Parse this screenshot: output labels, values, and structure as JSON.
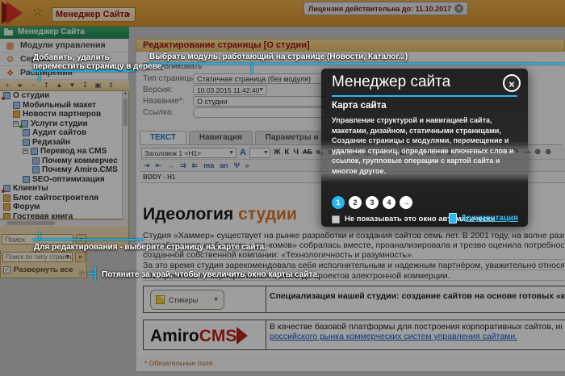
{
  "top_bar": {
    "app_menu_label": "Менеджер Сайта",
    "license_text": "Лицензия действительна до: 11.10.2017",
    "license_close": "×"
  },
  "sidebar": {
    "header": "Менеджер Сайта",
    "menu": [
      {
        "id": "modules",
        "icon": "modules-grid-icon",
        "glyph": "▦",
        "label": "Модули управления"
      },
      {
        "id": "service",
        "icon": "gear-icon",
        "glyph": "⚙",
        "label": "Сервис"
      },
      {
        "id": "extensions",
        "icon": "puzzle-icon",
        "glyph": "❖",
        "label": "Расширения"
      }
    ],
    "tree_toolbar": [
      {
        "name": "add-page-icon",
        "glyph": "+"
      },
      {
        "name": "select-page-icon",
        "glyph": "►"
      },
      {
        "name": "delete-page-icon",
        "glyph": "−"
      },
      {
        "name": "move-top-icon",
        "glyph": "↥"
      },
      {
        "name": "move-up-icon",
        "glyph": "▲"
      },
      {
        "name": "move-down-icon",
        "glyph": "▼"
      },
      {
        "name": "move-bottom-icon",
        "glyph": "↧"
      },
      {
        "name": "multiselect-icon",
        "glyph": "▣"
      },
      {
        "name": "expand-tree-icon",
        "glyph": "⇕"
      }
    ],
    "tree": [
      {
        "label": "О студии",
        "level": 0,
        "icon": "page",
        "marker": "red"
      },
      {
        "label": "Мобильный макет",
        "level": 1,
        "icon": "page"
      },
      {
        "label": "Новости партнеров",
        "level": 1,
        "icon": "module"
      },
      {
        "label": "Услуги студии",
        "level": 1,
        "icon": "page",
        "expander": "minus",
        "marker": "green"
      },
      {
        "label": "Аудит сайтов",
        "level": 2,
        "icon": "page"
      },
      {
        "label": "Редизайн",
        "level": 2,
        "icon": "page"
      },
      {
        "label": "Перевод на CMS",
        "level": 2,
        "icon": "page",
        "expander": "minus"
      },
      {
        "label": "Почему коммерчес",
        "level": 3,
        "icon": "page"
      },
      {
        "label": "Почему Amiro.CMS",
        "level": 3,
        "icon": "page"
      },
      {
        "label": "SEO-оптимизация",
        "level": 2,
        "icon": "page"
      },
      {
        "label": "Клиенты",
        "level": 0,
        "icon": "page",
        "marker": "red"
      },
      {
        "label": "Блог сайтостроителя",
        "level": 0,
        "icon": "module"
      },
      {
        "label": "Форум",
        "level": 0,
        "icon": "module"
      },
      {
        "label": "Гостевая книга",
        "level": 0,
        "icon": "module"
      }
    ],
    "search_value": "Поиск",
    "search_button": "»",
    "type_search_value": "Поиск по типу страницы",
    "type_search_button": "»",
    "expand_all_label": "Развернуть все"
  },
  "editor": {
    "title": "Редактирование страницы [О студии]",
    "publish_label": "Публиковать",
    "fields": [
      {
        "label": "Тип страницы:",
        "value": "Статичная страница (без модуля)",
        "type": "select"
      },
      {
        "label": "Версия:",
        "value": "10.03.2015 11:42:40",
        "type": "select"
      },
      {
        "label": "Название*:",
        "value": "О студии",
        "type": "input"
      },
      {
        "label": "Ссылка:",
        "value": "",
        "type": "input"
      }
    ],
    "tabs": [
      "ТЕКСТ",
      "Навигация",
      "Параметры и SEO"
    ],
    "toolbar": {
      "format_value": "Заголовок 1 <H1>",
      "font_button": "А",
      "icons_row1": [
        "Ж",
        "К",
        "Ч",
        "АБ",
        "x₂",
        "x²",
        "✎",
        "▤",
        "▤",
        "▤",
        "A▾",
        "◧▾",
        "≣",
        "≣",
        "≣",
        "≣",
        "≔",
        "≕",
        "⇥",
        "⇤",
        "↶",
        "↷",
        "—",
        "⊕",
        "⊕"
      ],
      "icons_row2": [
        "⇥",
        "⇤",
        "→",
        "⇉",
        "⇇",
        "ma",
        "an",
        "Ψ",
        "⌕"
      ]
    },
    "path": "BODY - H1",
    "content": {
      "heading_black": "Идеология",
      "heading_orange": "студии",
      "lines": [
        "Студия «Хаммер» существует на рынке разработки и создания сайтов семь лет. В 2001 году, на волне разочарования бизнес-",
        "разработчиков из бывших «дот-комов» собралась вместе, проанализировала и трезво оценила потребности рынка и собстве",
        "созданной собственной компании: «Технологичность и разумность».",
        "За это время студия зарекомендовала себя исполнительным и надежным партнёром, уважительно относящимся к потребнос",
        "500 проектов, от корпоративных сайтов до проектов электронной коммерции."
      ],
      "sticker_label": "Стикеры",
      "table1_right": "Специализация нашей студии: создание сайтов на основе готовых «коробочных» решений и перевод сай",
      "logo_black": "Amiro",
      "logo_red": "CMS",
      "table2_line1": "В качестве базовой платформы для построения корпоративных сайтов, интернет-магазинов и кон",
      "table2_link": "российского рынка коммерческих систем управления сайтами.",
      "footnote": "* Обязательные поля"
    }
  },
  "modal": {
    "title": "Менеджер сайта",
    "close_glyph": "×",
    "section_title": "Карта сайта",
    "body": "Управление структурой и навигацией сайта, макетами, дизайном, статичными страницами, Создание страницы с модулями, перемещение и удаление страниц, определение ключевых слов и ссылок, групповые операции с картой сайта и многое другое.",
    "pages": [
      "1",
      "2",
      "3",
      "4",
      "→"
    ],
    "active_page_index": 0,
    "dont_show_label": "Не показывать это окно автоматически",
    "doc_link_label": "Документация",
    "accent_color": "#29b7ef"
  },
  "tooltips": {
    "t1_line1": "Добавить, удалить",
    "t1_line2": "переместить страницу в дереве.",
    "t2": "Выбрать модуль, работающий на странице (Новости, Каталог...)",
    "t3": "Для редактирования - выберите страницу на карте сайта.",
    "t4": "Потяните за край, чтобы увеличить окно карты сайта."
  },
  "colors": {
    "accent_cyan": "#14b2e8",
    "topbar_orange": "#e9a63b",
    "sidebar_green": "#2f9e62",
    "title_red": "#a51212",
    "heading_orange": "#e07620",
    "link_blue": "#1d56c0"
  }
}
